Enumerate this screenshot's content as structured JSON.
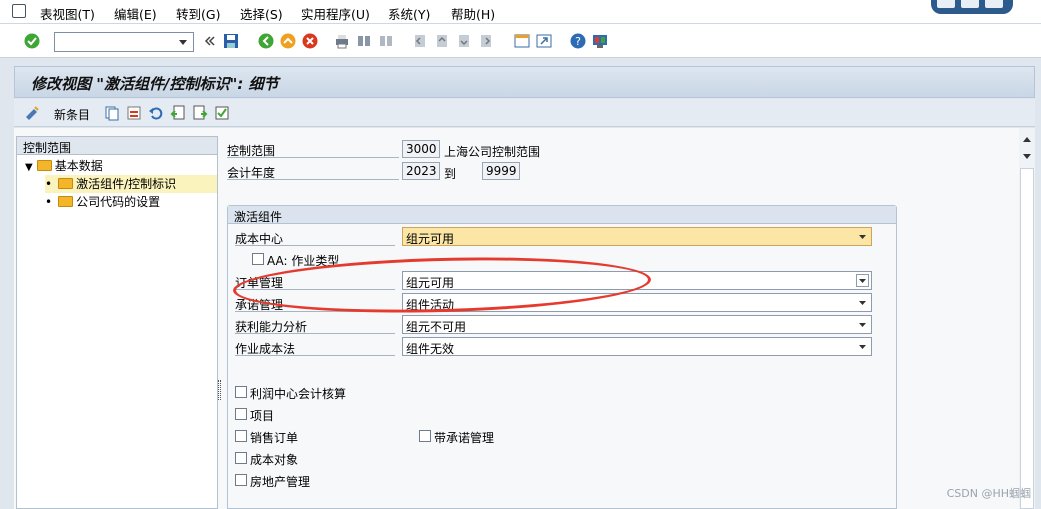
{
  "menubar": {
    "items": [
      "表视图(T)",
      "编辑(E)",
      "转到(G)",
      "选择(S)",
      "实用程序(U)",
      "系统(Y)",
      "帮助(H)"
    ]
  },
  "toolbar": {
    "command_value": ""
  },
  "titlebar": {
    "title": "修改视图 \"激活组件/控制标识\": 细节"
  },
  "app_toolbar": {
    "new_entries_label": "新条目"
  },
  "tree": {
    "header": "控制范围",
    "root": "基本数据",
    "children": [
      "激活组件/控制标识",
      "公司代码的设置"
    ]
  },
  "header_fields": {
    "controlling_area_label": "控制范围",
    "controlling_area_value": "3000",
    "controlling_area_desc": "上海公司控制范围",
    "fiscal_year_label": "会计年度",
    "fiscal_year_from": "2023",
    "fiscal_year_to_label": "到",
    "fiscal_year_to": "9999"
  },
  "group": {
    "title": "激活组件",
    "rows": [
      {
        "label": "成本中心",
        "value": "组元可用"
      },
      {
        "label": "订单管理",
        "value": "组元可用"
      },
      {
        "label": "承诺管理",
        "value": "组件活动"
      },
      {
        "label": "获利能力分析",
        "value": "组元不可用"
      },
      {
        "label": "作业成本法",
        "value": "组件无效"
      }
    ],
    "aa_label": "AA: 作业类型",
    "checkboxes": [
      "利润中心会计核算",
      "项目",
      "销售订单",
      "成本对象",
      "房地产管理"
    ],
    "commitment_checkbox": "带承诺管理"
  },
  "watermark": "CSDN @HH蝈蝈",
  "colors": {
    "accent_highlight": "#e53a2e",
    "required_field": "#fbe6a6",
    "tree_selected": "#fbf3bd"
  }
}
